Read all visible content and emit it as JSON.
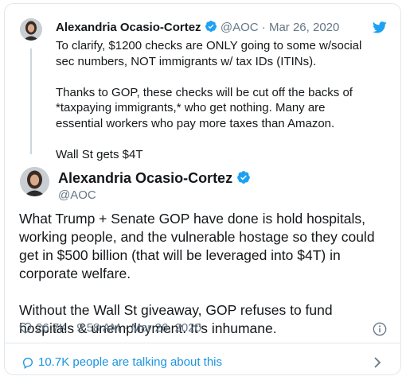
{
  "parent_tweet": {
    "author_name": "Alexandria Ocasio-Cortez",
    "meta": "@AOC · Mar 26, 2020",
    "paragraphs": [
      "To clarify, $1200 checks are ONLY going to some w/social sec numbers, NOT immigrants w/ tax IDs (ITINs).",
      "Thanks to GOP, these checks will be cut off the backs of *taxpaying immigrants,* who get nothing. Many are essential workers who pay more taxes than Amazon.",
      "Wall St gets $4T"
    ]
  },
  "main_tweet": {
    "author_name": "Alexandria Ocasio-Cortez",
    "handle": "@AOC",
    "paragraphs": [
      "What Trump + Senate GOP have done is hold hospitals, working people, and the vulnerable hostage so they could get in $500 billion (that will be leveraged into $4T) in corporate welfare.",
      "Without the Wall St giveaway, GOP refuses to fund hospitals & unemployment. It’s inhumane."
    ],
    "likes": "26.7K",
    "timestamp": "9:58 AM - Mar 26, 2020"
  },
  "footer": {
    "conversation_text": "10.7K people are talking about this"
  },
  "colors": {
    "accent": "#1da1f2",
    "link": "#1b95e0",
    "muted": "#657786",
    "border": "#e1e8ed"
  },
  "icons": [
    "twitter-bird-icon",
    "verified-badge-icon",
    "heart-icon",
    "info-icon",
    "comment-bubble-icon",
    "chevron-right-icon"
  ]
}
